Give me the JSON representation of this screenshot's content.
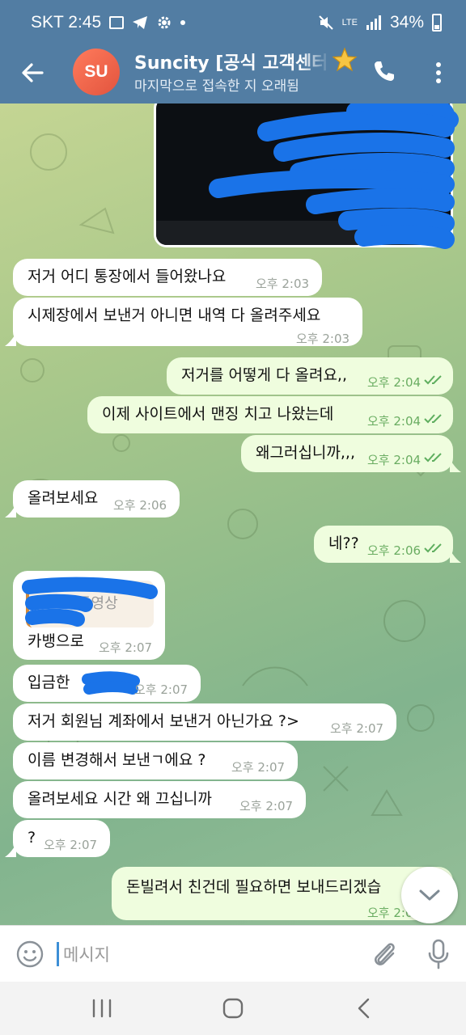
{
  "status_bar": {
    "carrier_time": "SKT 2:45",
    "battery": "34%",
    "network": "LTE"
  },
  "header": {
    "title": "Suncity [공식 고객센터",
    "subtitle": "마지막으로 접속한 지 오래됨",
    "avatar_initials": "SU"
  },
  "messages": [
    {
      "dir": "in",
      "text": "저거 어디 통장에서 들어왔나요",
      "time": "오후 2:03"
    },
    {
      "dir": "in",
      "text": "시제장에서 보낸거 아니면 내역 다 올려주세요",
      "time": "오후 2:03"
    },
    {
      "dir": "out",
      "text": "저거를 어떻게 다 올려요,,",
      "time": "오후 2:04"
    },
    {
      "dir": "out",
      "text": "이제 사이트에서 맨징 치고 나왔는데",
      "time": "오후 2:04"
    },
    {
      "dir": "out",
      "text": "왜그러십니까,,,",
      "time": "오후 2:04"
    },
    {
      "dir": "in",
      "text": "올려보세요",
      "time": "오후 2:06"
    },
    {
      "dir": "out",
      "text": "네??",
      "time": "오후 2:06"
    },
    {
      "dir": "in",
      "reply_label": "동영상",
      "text": "카뱅으로",
      "time": "오후 2:07"
    },
    {
      "dir": "in",
      "text": "입금한",
      "time": "오후 2:07"
    },
    {
      "dir": "in",
      "text": "저거 회원님 계좌에서 보낸거 아닌가요 ?>",
      "time": "오후 2:07"
    },
    {
      "dir": "in",
      "text": "이름 변경해서 보낸ㄱ에요 ?",
      "time": "오후 2:07"
    },
    {
      "dir": "in",
      "text": "올려보세요 시간 왜 끄십니까",
      "time": "오후 2:07"
    },
    {
      "dir": "in",
      "text": "?",
      "time": "오후 2:07"
    },
    {
      "dir": "out",
      "text": "돈빌려서 친건데 필요하면 보내드리겠습",
      "time": "오후 2:0"
    }
  ],
  "input": {
    "placeholder": "메시지"
  },
  "colors": {
    "header": "#527da3",
    "incoming_bubble": "#ffffff",
    "outgoing_bubble": "#effdde",
    "outgoing_time": "#6aad62",
    "redaction": "#1a73e8",
    "avatar": "#e2543e"
  },
  "icons": [
    "back-arrow-icon",
    "star-icon",
    "phone-icon",
    "more-vert-icon",
    "double-check-icon",
    "chevron-down-icon",
    "emoji-icon",
    "attach-icon",
    "mic-icon",
    "nav-recent-icon",
    "nav-home-icon",
    "nav-back-icon"
  ]
}
